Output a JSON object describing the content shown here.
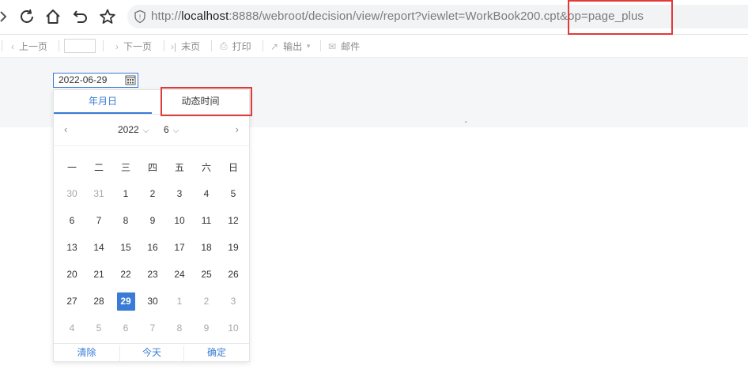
{
  "browser": {
    "url_prefix": "http://",
    "url_host": "localhost",
    "url_rest": ":8888/webroot/decision/view/report?viewlet=WorkBook200.cpt&op=page_plus"
  },
  "toolbar": {
    "prev_page": "上一页",
    "next_page": "下一页",
    "last_page": "末页",
    "print": "打印",
    "export": "输出",
    "email": "邮件",
    "page_number": ""
  },
  "parameters": {
    "date_value": "2022-06-29"
  },
  "datepicker": {
    "tab_date": "年月日",
    "tab_dynamic": "动态时间",
    "year": "2022",
    "month": "6",
    "weekdays": [
      "一",
      "二",
      "三",
      "四",
      "五",
      "六",
      "日"
    ],
    "weeks": [
      [
        {
          "d": "30",
          "o": true
        },
        {
          "d": "31",
          "o": true
        },
        {
          "d": "1"
        },
        {
          "d": "2"
        },
        {
          "d": "3"
        },
        {
          "d": "4"
        },
        {
          "d": "5"
        }
      ],
      [
        {
          "d": "6"
        },
        {
          "d": "7"
        },
        {
          "d": "8"
        },
        {
          "d": "9"
        },
        {
          "d": "10"
        },
        {
          "d": "11"
        },
        {
          "d": "12"
        }
      ],
      [
        {
          "d": "13"
        },
        {
          "d": "14"
        },
        {
          "d": "15"
        },
        {
          "d": "16"
        },
        {
          "d": "17"
        },
        {
          "d": "18"
        },
        {
          "d": "19"
        }
      ],
      [
        {
          "d": "20"
        },
        {
          "d": "21"
        },
        {
          "d": "22"
        },
        {
          "d": "23"
        },
        {
          "d": "24"
        },
        {
          "d": "25"
        },
        {
          "d": "26"
        }
      ],
      [
        {
          "d": "27"
        },
        {
          "d": "28"
        },
        {
          "d": "29",
          "s": true
        },
        {
          "d": "30"
        },
        {
          "d": "1",
          "o": true
        },
        {
          "d": "2",
          "o": true
        },
        {
          "d": "3",
          "o": true
        }
      ],
      [
        {
          "d": "4",
          "o": true
        },
        {
          "d": "5",
          "o": true
        },
        {
          "d": "6",
          "o": true
        },
        {
          "d": "7",
          "o": true
        },
        {
          "d": "8",
          "o": true
        },
        {
          "d": "9",
          "o": true
        },
        {
          "d": "10",
          "o": true
        }
      ]
    ],
    "footer": {
      "clear": "清除",
      "today": "今天",
      "confirm": "确定"
    }
  },
  "colors": {
    "accent": "#3a7bd5",
    "highlight_box": "#e03a3a"
  }
}
